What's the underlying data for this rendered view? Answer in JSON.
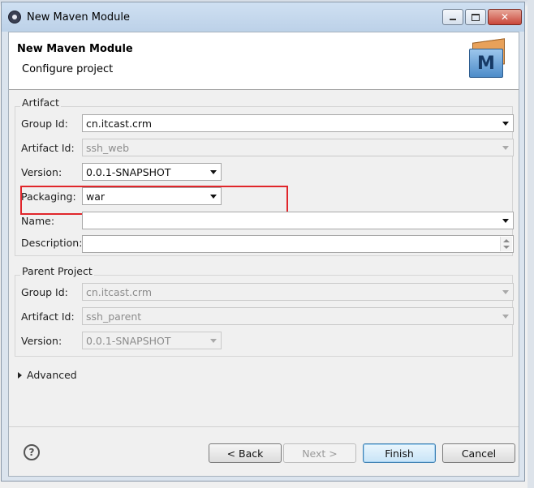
{
  "window": {
    "title": "New Maven Module"
  },
  "banner": {
    "title": "New Maven Module",
    "subtitle": "Configure project",
    "logo_letter": "M"
  },
  "artifact": {
    "legend": "Artifact",
    "group_id": {
      "label": "Group Id:",
      "value": "cn.itcast.crm"
    },
    "artifact_id": {
      "label": "Artifact Id:",
      "value": "ssh_web"
    },
    "version": {
      "label": "Version:",
      "value": "0.0.1-SNAPSHOT"
    },
    "packaging": {
      "label": "Packaging:",
      "value": "war"
    },
    "name": {
      "label": "Name:",
      "value": ""
    },
    "description": {
      "label": "Description:",
      "value": ""
    }
  },
  "parent": {
    "legend": "Parent Project",
    "group_id": {
      "label": "Group Id:",
      "value": "cn.itcast.crm"
    },
    "artifact_id": {
      "label": "Artifact Id:",
      "value": "ssh_parent"
    },
    "version": {
      "label": "Version:",
      "value": "0.0.1-SNAPSHOT"
    }
  },
  "advanced": {
    "label": "Advanced"
  },
  "buttons": {
    "help": "?",
    "back": "< Back",
    "next": "Next >",
    "finish": "Finish",
    "cancel": "Cancel"
  },
  "colors": {
    "highlight": "#e0262b",
    "default_button_border": "#3c7fb1"
  }
}
